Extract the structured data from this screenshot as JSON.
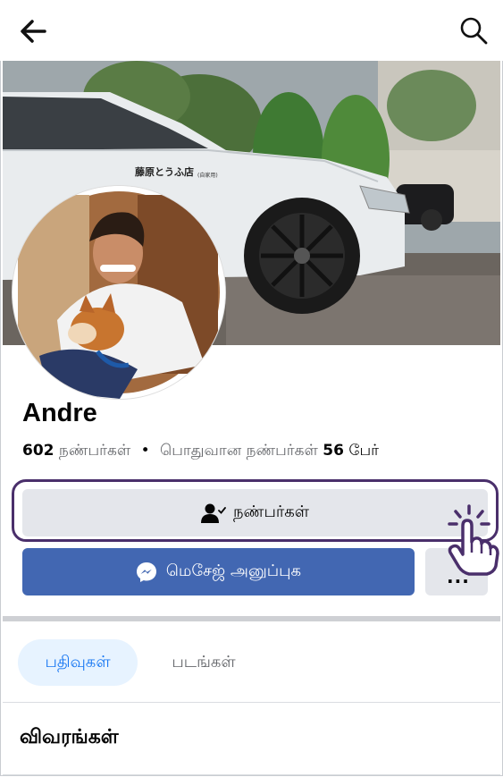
{
  "header": {
    "back_icon": "arrow-left-icon",
    "search_icon": "search-icon"
  },
  "profile": {
    "name": "Andre",
    "friends_count": "602",
    "friends_label": "நண்பர்கள்",
    "separator": "•",
    "mutual_label": "பொதுவான நண்பர்கள்",
    "mutual_count": "56",
    "mutual_suffix": "பேர்"
  },
  "cover": {
    "car_text": "藤原とうふ店",
    "car_subtext": "(自家用)"
  },
  "actions": {
    "friends_button": "நண்பர்கள்",
    "friends_icon": "person-check-icon",
    "message_button": "மெசேஜ் அனுப்புக",
    "message_icon": "messenger-icon",
    "more_button": "..."
  },
  "tabs": [
    {
      "label": "பதிவுகள்",
      "active": true
    },
    {
      "label": "படங்கள்",
      "active": false
    }
  ],
  "details": {
    "title": "விவரங்கள்"
  },
  "colors": {
    "accent": "#1877f2",
    "messenger_button": "#4267b2",
    "highlight_border": "#4a2f6b"
  }
}
